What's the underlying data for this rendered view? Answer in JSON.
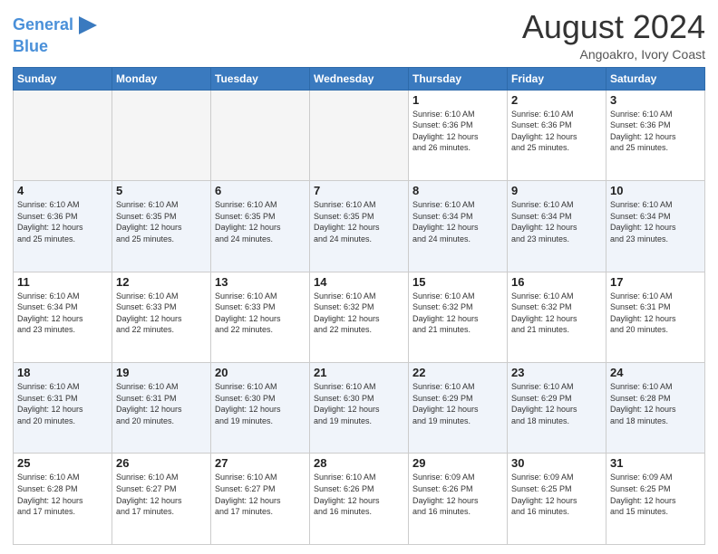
{
  "header": {
    "logo_line1": "General",
    "logo_line2": "Blue",
    "main_title": "August 2024",
    "subtitle": "Angoakro, Ivory Coast"
  },
  "days_of_week": [
    "Sunday",
    "Monday",
    "Tuesday",
    "Wednesday",
    "Thursday",
    "Friday",
    "Saturday"
  ],
  "weeks": [
    [
      {
        "day": "",
        "info": "",
        "empty": true
      },
      {
        "day": "",
        "info": "",
        "empty": true
      },
      {
        "day": "",
        "info": "",
        "empty": true
      },
      {
        "day": "",
        "info": "",
        "empty": true
      },
      {
        "day": "1",
        "info": "Sunrise: 6:10 AM\nSunset: 6:36 PM\nDaylight: 12 hours\nand 26 minutes.",
        "empty": false
      },
      {
        "day": "2",
        "info": "Sunrise: 6:10 AM\nSunset: 6:36 PM\nDaylight: 12 hours\nand 25 minutes.",
        "empty": false
      },
      {
        "day": "3",
        "info": "Sunrise: 6:10 AM\nSunset: 6:36 PM\nDaylight: 12 hours\nand 25 minutes.",
        "empty": false
      }
    ],
    [
      {
        "day": "4",
        "info": "Sunrise: 6:10 AM\nSunset: 6:36 PM\nDaylight: 12 hours\nand 25 minutes.",
        "empty": false
      },
      {
        "day": "5",
        "info": "Sunrise: 6:10 AM\nSunset: 6:35 PM\nDaylight: 12 hours\nand 25 minutes.",
        "empty": false
      },
      {
        "day": "6",
        "info": "Sunrise: 6:10 AM\nSunset: 6:35 PM\nDaylight: 12 hours\nand 24 minutes.",
        "empty": false
      },
      {
        "day": "7",
        "info": "Sunrise: 6:10 AM\nSunset: 6:35 PM\nDaylight: 12 hours\nand 24 minutes.",
        "empty": false
      },
      {
        "day": "8",
        "info": "Sunrise: 6:10 AM\nSunset: 6:34 PM\nDaylight: 12 hours\nand 24 minutes.",
        "empty": false
      },
      {
        "day": "9",
        "info": "Sunrise: 6:10 AM\nSunset: 6:34 PM\nDaylight: 12 hours\nand 23 minutes.",
        "empty": false
      },
      {
        "day": "10",
        "info": "Sunrise: 6:10 AM\nSunset: 6:34 PM\nDaylight: 12 hours\nand 23 minutes.",
        "empty": false
      }
    ],
    [
      {
        "day": "11",
        "info": "Sunrise: 6:10 AM\nSunset: 6:34 PM\nDaylight: 12 hours\nand 23 minutes.",
        "empty": false
      },
      {
        "day": "12",
        "info": "Sunrise: 6:10 AM\nSunset: 6:33 PM\nDaylight: 12 hours\nand 22 minutes.",
        "empty": false
      },
      {
        "day": "13",
        "info": "Sunrise: 6:10 AM\nSunset: 6:33 PM\nDaylight: 12 hours\nand 22 minutes.",
        "empty": false
      },
      {
        "day": "14",
        "info": "Sunrise: 6:10 AM\nSunset: 6:32 PM\nDaylight: 12 hours\nand 22 minutes.",
        "empty": false
      },
      {
        "day": "15",
        "info": "Sunrise: 6:10 AM\nSunset: 6:32 PM\nDaylight: 12 hours\nand 21 minutes.",
        "empty": false
      },
      {
        "day": "16",
        "info": "Sunrise: 6:10 AM\nSunset: 6:32 PM\nDaylight: 12 hours\nand 21 minutes.",
        "empty": false
      },
      {
        "day": "17",
        "info": "Sunrise: 6:10 AM\nSunset: 6:31 PM\nDaylight: 12 hours\nand 20 minutes.",
        "empty": false
      }
    ],
    [
      {
        "day": "18",
        "info": "Sunrise: 6:10 AM\nSunset: 6:31 PM\nDaylight: 12 hours\nand 20 minutes.",
        "empty": false
      },
      {
        "day": "19",
        "info": "Sunrise: 6:10 AM\nSunset: 6:31 PM\nDaylight: 12 hours\nand 20 minutes.",
        "empty": false
      },
      {
        "day": "20",
        "info": "Sunrise: 6:10 AM\nSunset: 6:30 PM\nDaylight: 12 hours\nand 19 minutes.",
        "empty": false
      },
      {
        "day": "21",
        "info": "Sunrise: 6:10 AM\nSunset: 6:30 PM\nDaylight: 12 hours\nand 19 minutes.",
        "empty": false
      },
      {
        "day": "22",
        "info": "Sunrise: 6:10 AM\nSunset: 6:29 PM\nDaylight: 12 hours\nand 19 minutes.",
        "empty": false
      },
      {
        "day": "23",
        "info": "Sunrise: 6:10 AM\nSunset: 6:29 PM\nDaylight: 12 hours\nand 18 minutes.",
        "empty": false
      },
      {
        "day": "24",
        "info": "Sunrise: 6:10 AM\nSunset: 6:28 PM\nDaylight: 12 hours\nand 18 minutes.",
        "empty": false
      }
    ],
    [
      {
        "day": "25",
        "info": "Sunrise: 6:10 AM\nSunset: 6:28 PM\nDaylight: 12 hours\nand 17 minutes.",
        "empty": false
      },
      {
        "day": "26",
        "info": "Sunrise: 6:10 AM\nSunset: 6:27 PM\nDaylight: 12 hours\nand 17 minutes.",
        "empty": false
      },
      {
        "day": "27",
        "info": "Sunrise: 6:10 AM\nSunset: 6:27 PM\nDaylight: 12 hours\nand 17 minutes.",
        "empty": false
      },
      {
        "day": "28",
        "info": "Sunrise: 6:10 AM\nSunset: 6:26 PM\nDaylight: 12 hours\nand 16 minutes.",
        "empty": false
      },
      {
        "day": "29",
        "info": "Sunrise: 6:09 AM\nSunset: 6:26 PM\nDaylight: 12 hours\nand 16 minutes.",
        "empty": false
      },
      {
        "day": "30",
        "info": "Sunrise: 6:09 AM\nSunset: 6:25 PM\nDaylight: 12 hours\nand 16 minutes.",
        "empty": false
      },
      {
        "day": "31",
        "info": "Sunrise: 6:09 AM\nSunset: 6:25 PM\nDaylight: 12 hours\nand 15 minutes.",
        "empty": false
      }
    ]
  ]
}
